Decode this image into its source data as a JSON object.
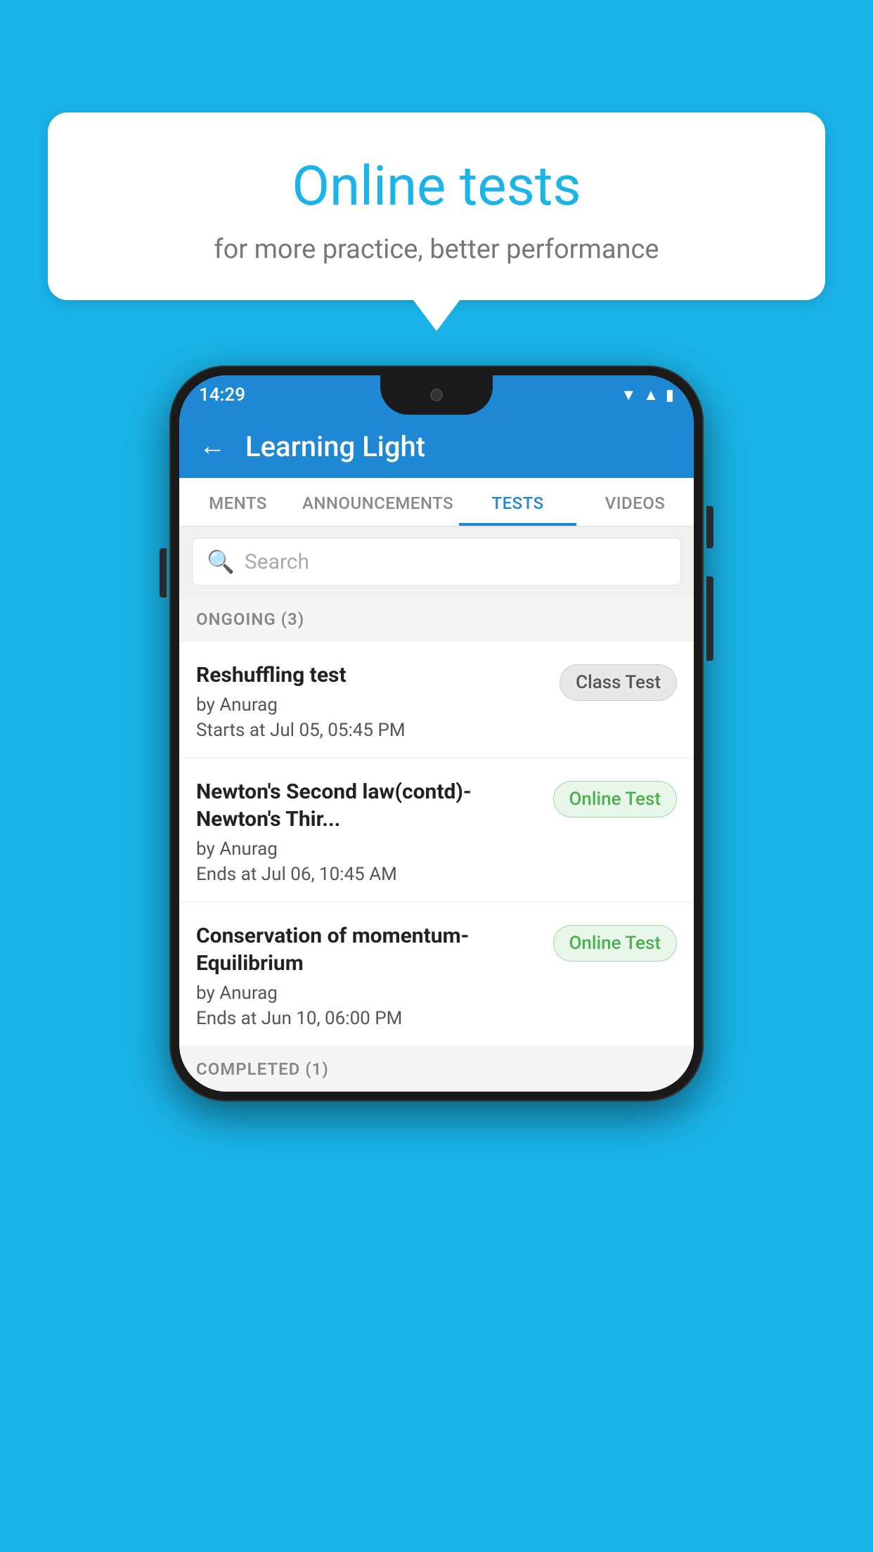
{
  "background_color": "#1ab4e8",
  "bubble": {
    "title": "Online tests",
    "subtitle": "for more practice, better performance"
  },
  "phone": {
    "status_bar": {
      "time": "14:29",
      "icons": [
        "wifi",
        "signal",
        "battery"
      ]
    },
    "header": {
      "back_label": "←",
      "title": "Learning Light"
    },
    "tabs": [
      {
        "label": "MENTS",
        "active": false
      },
      {
        "label": "ANNOUNCEMENTS",
        "active": false
      },
      {
        "label": "TESTS",
        "active": true
      },
      {
        "label": "VIDEOS",
        "active": false
      }
    ],
    "search": {
      "placeholder": "Search"
    },
    "ongoing_section": {
      "header": "ONGOING (3)",
      "tests": [
        {
          "name": "Reshuffling test",
          "author": "by Anurag",
          "date": "Starts at  Jul 05, 05:45 PM",
          "badge": "Class Test",
          "badge_type": "class"
        },
        {
          "name": "Newton's Second law(contd)-Newton's Thir...",
          "author": "by Anurag",
          "date": "Ends at  Jul 06, 10:45 AM",
          "badge": "Online Test",
          "badge_type": "online"
        },
        {
          "name": "Conservation of momentum-Equilibrium",
          "author": "by Anurag",
          "date": "Ends at  Jun 10, 06:00 PM",
          "badge": "Online Test",
          "badge_type": "online"
        }
      ]
    },
    "completed_section": {
      "header": "COMPLETED (1)"
    }
  }
}
